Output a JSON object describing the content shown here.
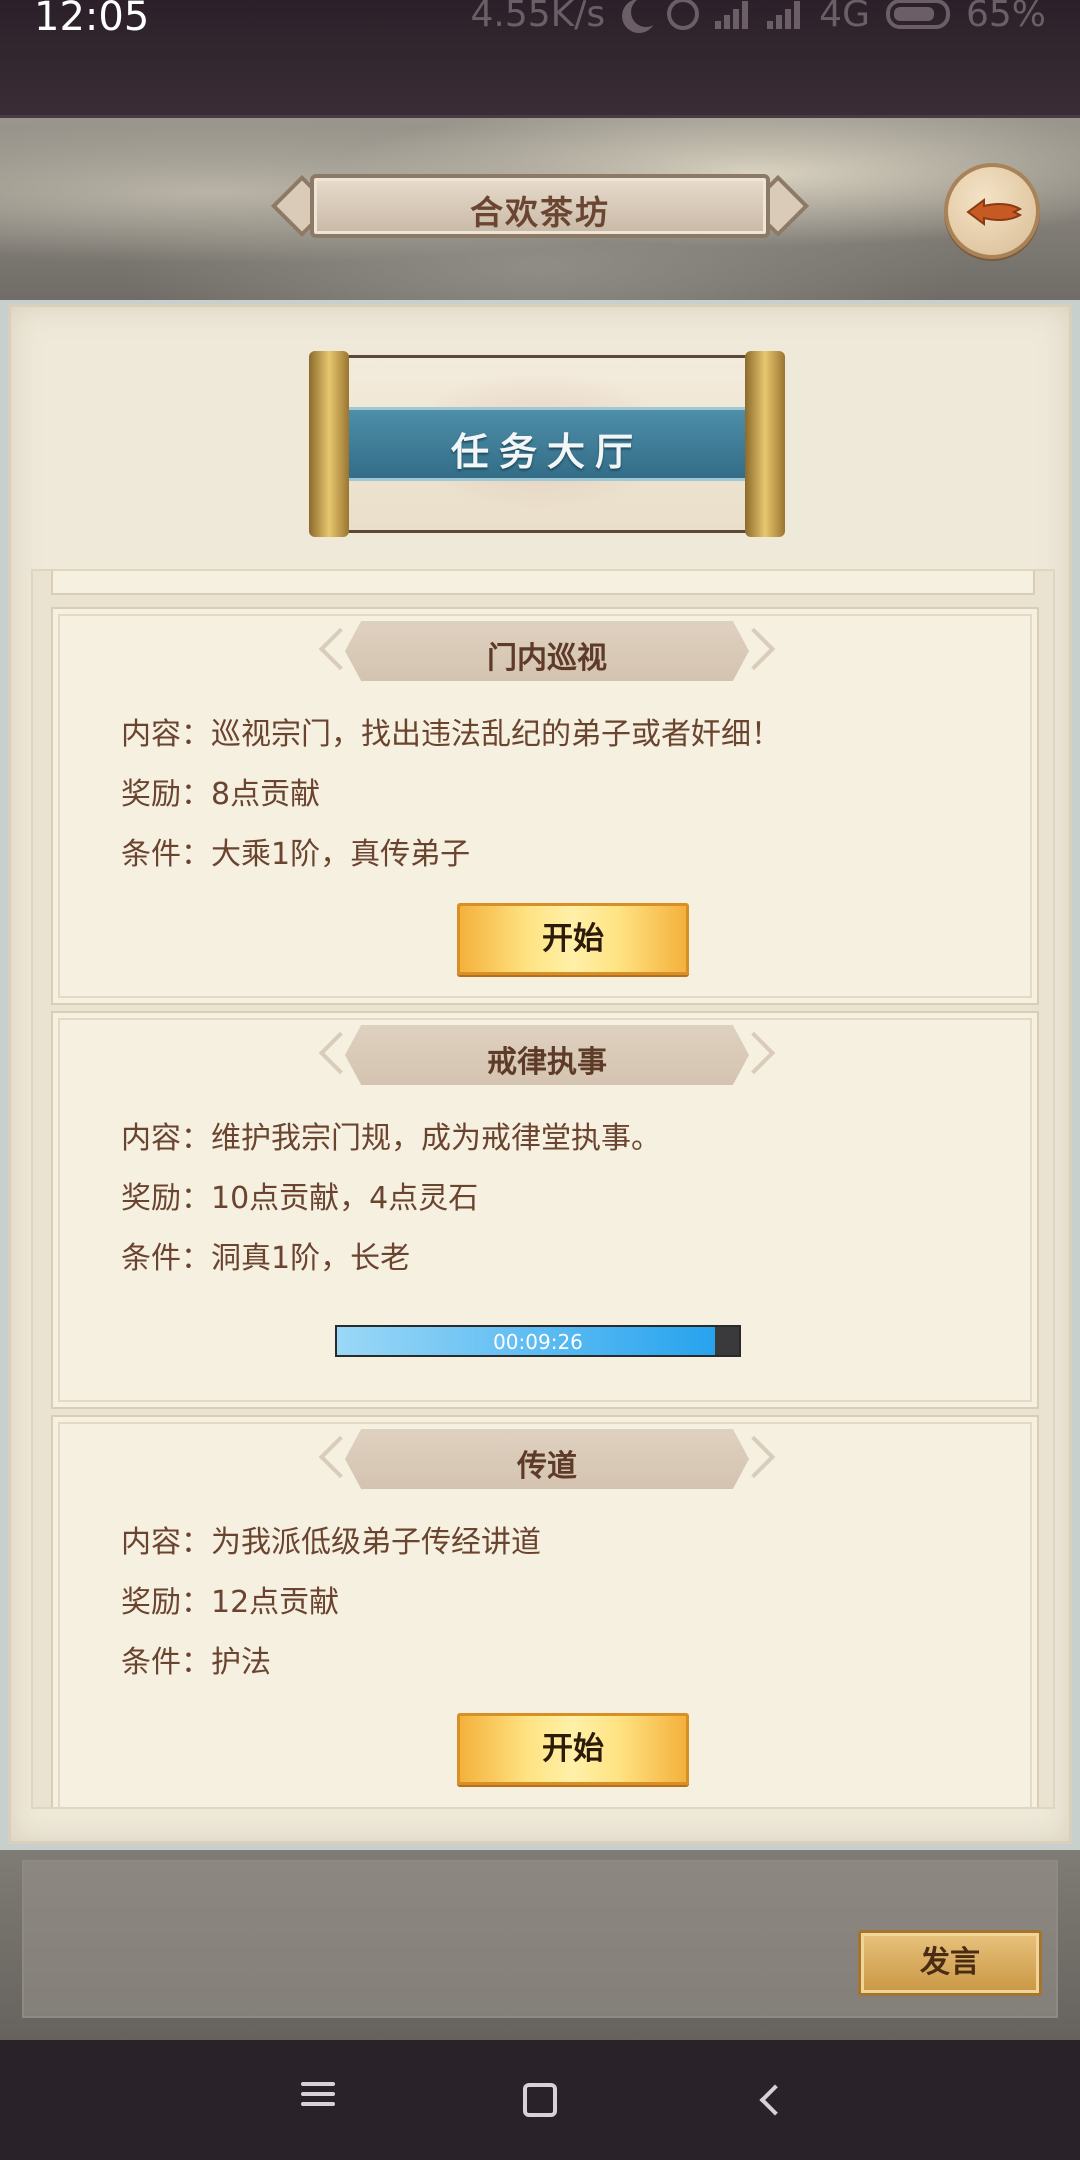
{
  "status_bar": {
    "time": "12:05",
    "network_speed": "4.55K/s",
    "network_type": "4G",
    "battery": "65%"
  },
  "header": {
    "title": "合欢茶坊"
  },
  "hall": {
    "title": "任务大厅"
  },
  "tasks": [
    {
      "name": "门内巡视",
      "content": "内容：巡视宗门，找出违法乱纪的弟子或者奸细！",
      "reward": "奖励：8点贡献",
      "condition": "条件：大乘1阶，真传弟子",
      "action_label": "开始"
    },
    {
      "name": "戒律执事",
      "content": "内容：维护我宗门规，成为戒律堂执事。",
      "reward": "奖励：10点贡献，4点灵石",
      "condition": "条件：洞真1阶，长老",
      "timer": "00:09:26",
      "progress": 0.94
    },
    {
      "name": "传道",
      "content": "内容：为我派低级弟子传经讲道",
      "reward": "奖励：12点贡献",
      "condition": "条件：护法",
      "action_label": "开始"
    }
  ],
  "chat": {
    "send_label": "发言"
  },
  "icons": {
    "back": "back-arrow-icon",
    "moon": "do-not-disturb-icon",
    "alarm": "alarm-icon",
    "signal": "signal-icon",
    "battery": "battery-icon",
    "nav_menu": "menu-icon",
    "nav_home": "home-icon",
    "nav_back": "back-icon"
  },
  "colors": {
    "parchment": "#f6f0e1",
    "title_brown": "#5e3a28",
    "button_gold": "#ffe383",
    "progress_blue": "#27a3ee"
  }
}
